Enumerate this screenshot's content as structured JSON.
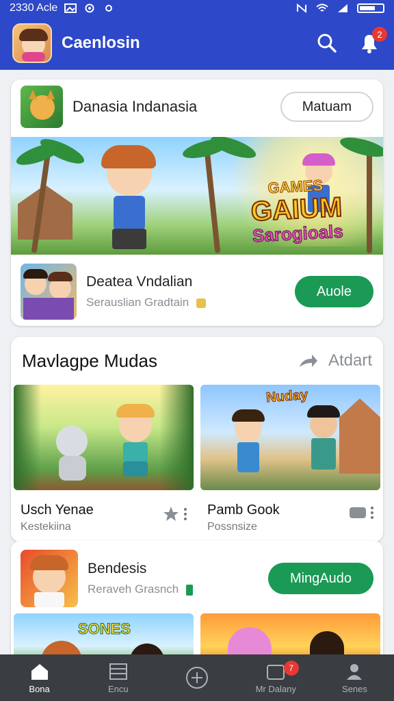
{
  "status_bar": {
    "time": "2330 Acle"
  },
  "app_bar": {
    "title": "Caenlosin",
    "notification_count": "2"
  },
  "card1": {
    "title": "Danasia Indanasia",
    "button": "Matuam",
    "banner": {
      "line1": "GAMES",
      "line2": "GAIUM",
      "line3": "Sarogioals"
    },
    "game_title": "Deatea Vndalian",
    "game_subtitle": "Serauslian Gradtain",
    "action_button": "Auole"
  },
  "card2": {
    "title": "Mavlagpe Mudas",
    "action": "Atdart",
    "tiles": [
      {
        "title": "Usch Yenae",
        "subtitle": "Kestekiina"
      },
      {
        "title": "Pamb Gook",
        "subtitle": "Possnsize",
        "overlay": "Nuday"
      }
    ]
  },
  "card3": {
    "title": "Bendesis",
    "subtitle": "Reraveh Grasnch",
    "button": "MingAudo",
    "tile_overlay": "SONES"
  },
  "bottom_nav": {
    "items": [
      {
        "label": "Bona"
      },
      {
        "label": "Encu"
      },
      {
        "label": ""
      },
      {
        "label": "Mr Dalany",
        "badge": "7"
      },
      {
        "label": "Senes"
      }
    ]
  },
  "colors": {
    "primary": "#2d48c8",
    "accent_green": "#1a9a55",
    "badge_red": "#e53935",
    "nav_bg": "#3a3d42"
  }
}
